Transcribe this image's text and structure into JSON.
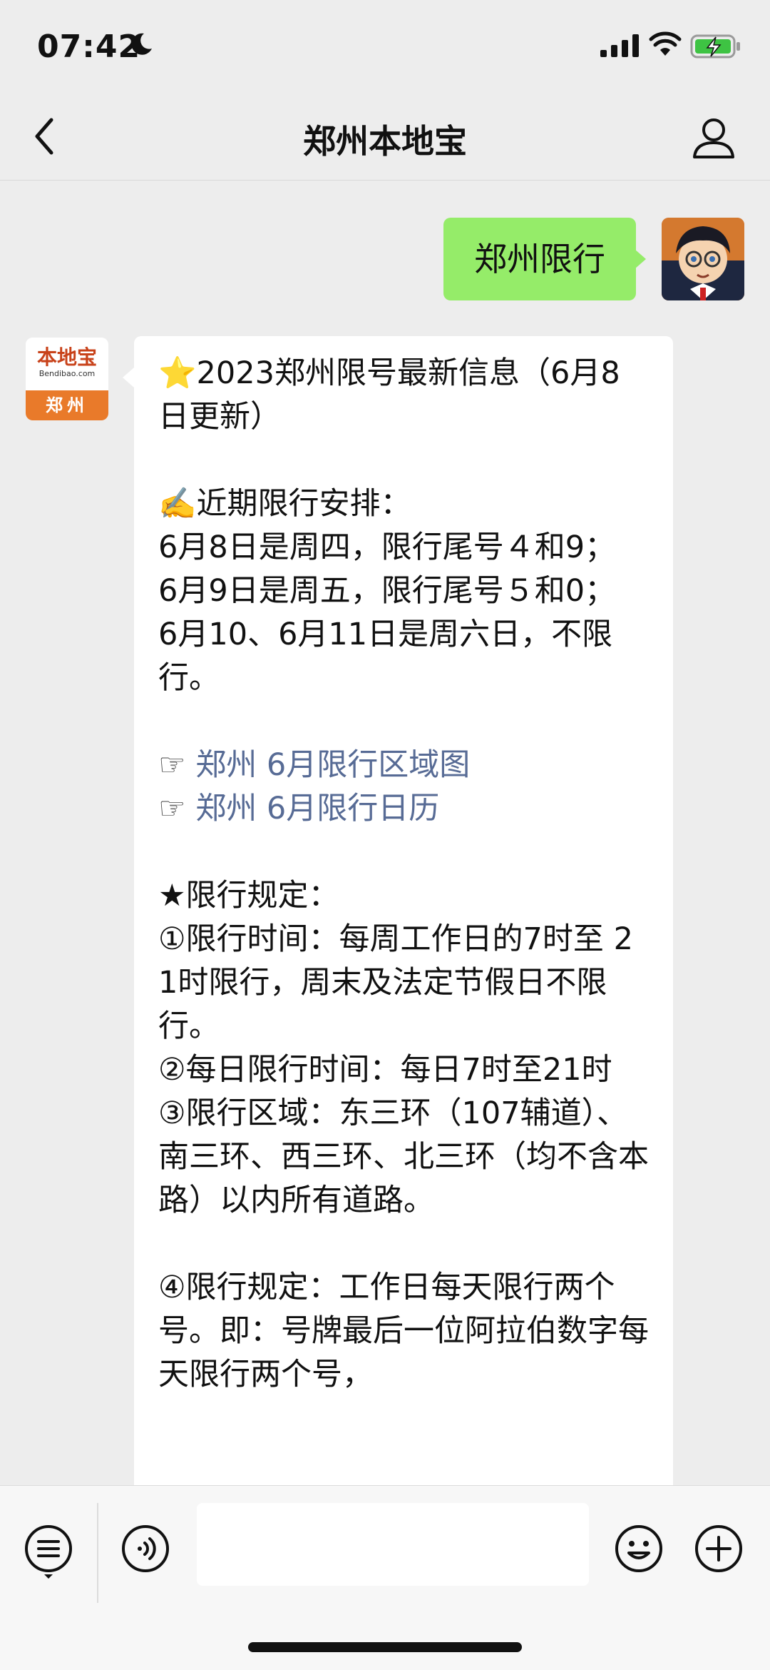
{
  "status_bar": {
    "time": "07:42"
  },
  "nav": {
    "title": "郑州本地宝"
  },
  "messages": {
    "sent_text": "郑州限行",
    "bot_avatar": {
      "logo_cn": "本地宝",
      "logo_url": "Bendibao.com",
      "city": "郑州"
    },
    "received": {
      "line1": "⭐2023郑州限号最新信息（6月8日更新）",
      "line2": "✍️近期限行安排：",
      "line3": "6月8日是周四，限行尾号４和9；",
      "line4": "6月9日是周五，限行尾号５和0；",
      "line5": "6月10、6月11日是周六日，不限行。",
      "link1_prefix": "☞ ",
      "link1": "郑州 6月限行区域图",
      "link2_prefix": "☞ ",
      "link2": "郑州 6月限行日历",
      "rules_title": "★限行规定：",
      "rule1": "①限行时间：每周工作日的7时至 21时限行，周末及法定节假日不限行。",
      "rule2": "②每日限行时间：每日7时至21时",
      "rule3": "③限行区域：东三环（107辅道）、南三环、西三环、北三环（均不含本路）以内所有道路。",
      "rule4": "④限行规定：工作日每天限行两个号。即：号牌最后一位阿拉伯数字每天限行两个号，"
    }
  },
  "colors": {
    "background": "#ededed",
    "sent_bubble": "#95ec69",
    "link": "#576b95",
    "brand_orange": "#e97a2a"
  },
  "icons": [
    "back-arrow-icon",
    "person-icon",
    "moon-icon",
    "signal-icon",
    "wifi-icon",
    "battery-charging-icon",
    "menu-list-icon",
    "voice-icon",
    "emoji-icon",
    "plus-icon"
  ]
}
